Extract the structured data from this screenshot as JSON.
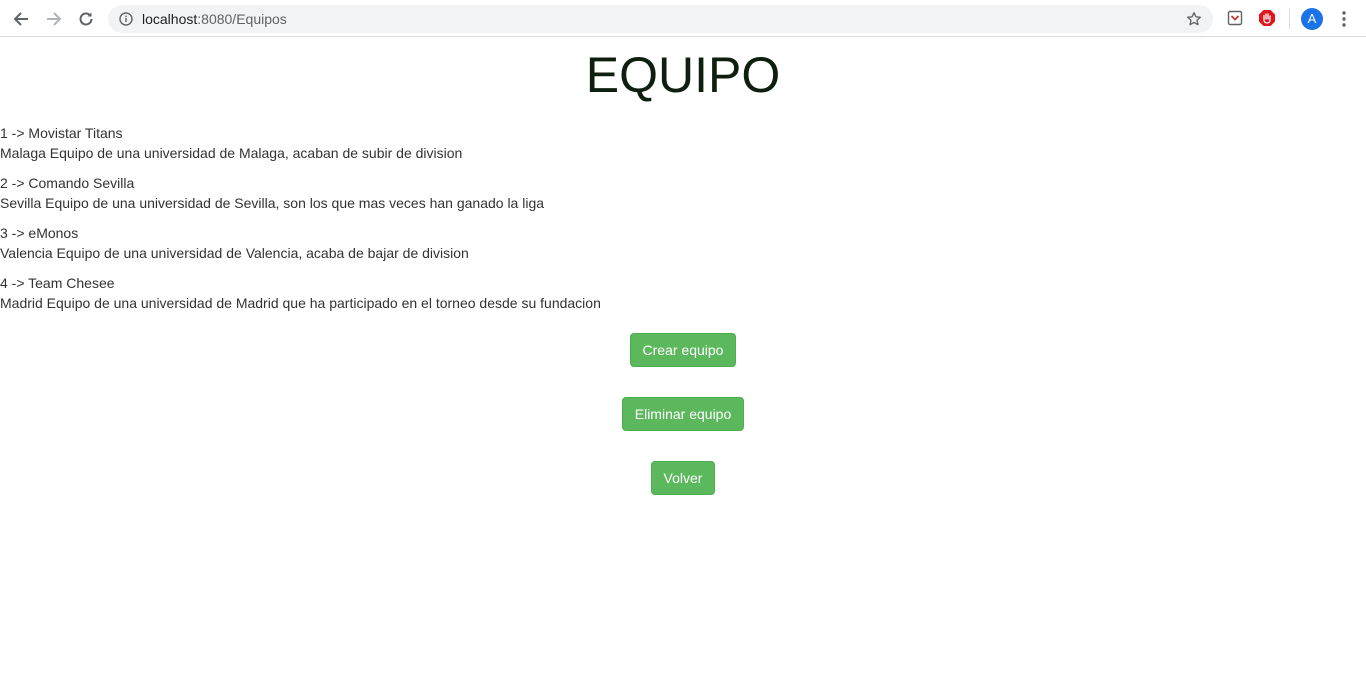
{
  "browser": {
    "url_host": "localhost",
    "url_path": ":8080/Equipos",
    "profile_initial": "A"
  },
  "icons": {
    "back": "back-arrow-icon",
    "forward": "forward-arrow-icon",
    "reload": "reload-icon",
    "site_info": "info-icon",
    "bookmark": "star-icon",
    "extension_1": "pocket-icon",
    "extension_2": "adblock-icon",
    "menu": "kebab-menu-icon"
  },
  "colors": {
    "button_green": "#5cb85c",
    "title": "#0f1f0f",
    "text": "#333333",
    "avatar": "#1a73e8",
    "adblock": "#e0161d"
  },
  "page": {
    "title": "EQUIPO"
  },
  "teams": [
    {
      "heading": "1 -> Movistar Titans",
      "description": "Malaga Equipo de una universidad de Malaga, acaban de subir de division"
    },
    {
      "heading": "2 -> Comando Sevilla",
      "description": "Sevilla Equipo de una universidad de Sevilla, son los que mas veces han ganado la liga"
    },
    {
      "heading": "3 -> eMonos",
      "description": "Valencia Equipo de una universidad de Valencia, acaba de bajar de division"
    },
    {
      "heading": "4 -> Team Chesee",
      "description": "Madrid Equipo de una universidad de Madrid que ha participado en el torneo desde su fundacion"
    }
  ],
  "actions": {
    "create": "Crear equipo",
    "delete": "Eliminar equipo",
    "back": "Volver"
  }
}
